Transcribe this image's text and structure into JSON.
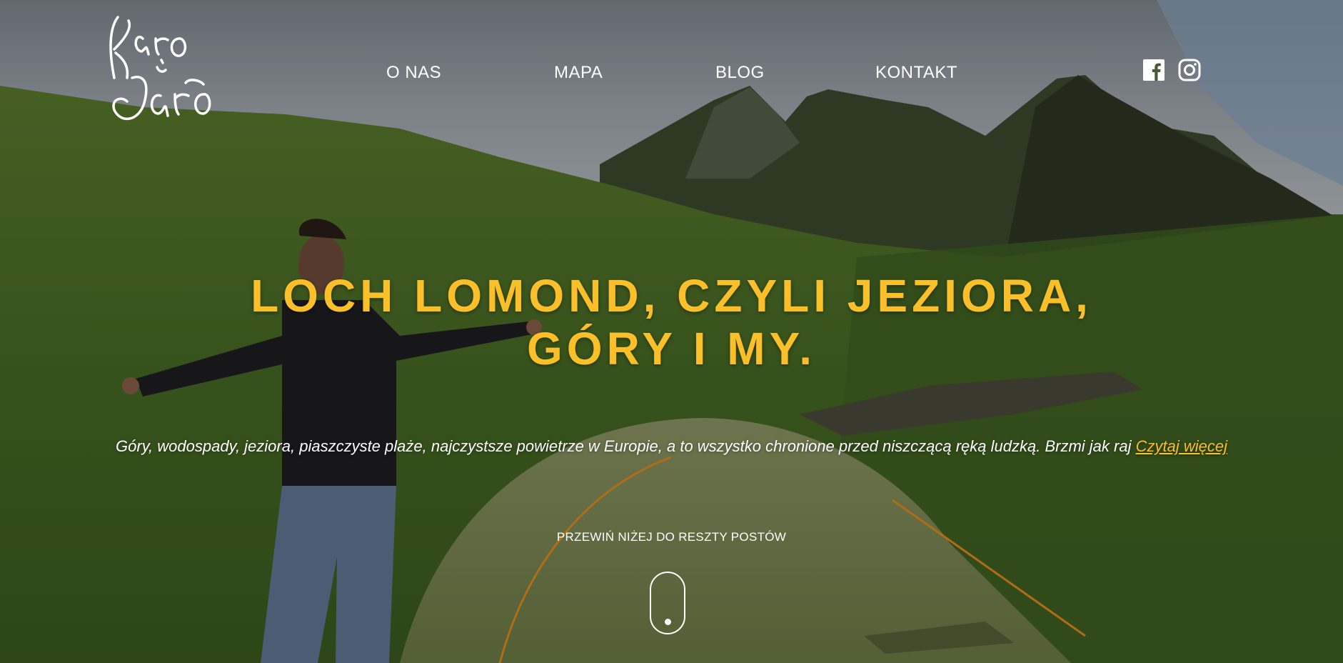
{
  "header": {
    "logo_text": "Karo i Jaro",
    "nav": [
      {
        "label": "O NAS"
      },
      {
        "label": "MAPA"
      },
      {
        "label": "BLOG"
      },
      {
        "label": "KONTAKT"
      }
    ],
    "social": [
      {
        "icon": "facebook-icon"
      },
      {
        "icon": "instagram-icon"
      }
    ]
  },
  "hero": {
    "title_line1": "LOCH LOMOND, CZYLI JEZIORA,",
    "title_line2": "GÓRY I MY.",
    "excerpt": "Góry, wodospady, jeziora, piaszczyste plaże, najczystsze powietrze w Europie, a to wszystko chronione przed niszczącą ręką ludzką. Brzmi jak raj",
    "read_more": "Czytaj więcej",
    "scroll_hint": "PRZEWIŃ NIŻEJ DO RESZTY POSTÓW"
  },
  "colors": {
    "accent": "#fbbf2a",
    "text": "#ffffff"
  }
}
